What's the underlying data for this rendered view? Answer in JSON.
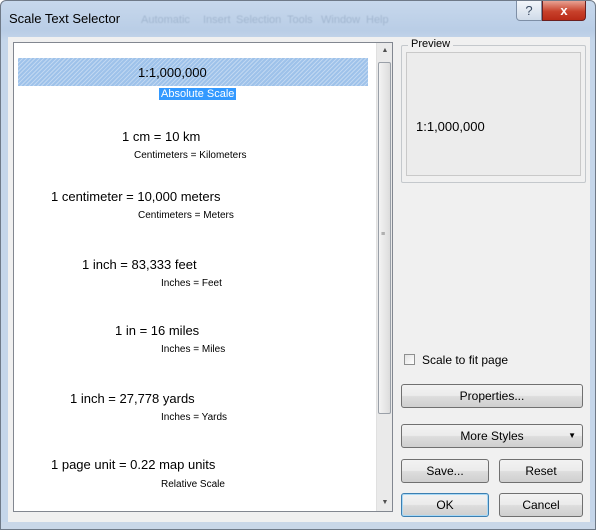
{
  "window": {
    "title": "Scale Text Selector",
    "background_menu_ghost": [
      "Automatic",
      "Insert",
      "Selection",
      "Tools",
      "Window",
      "Help"
    ],
    "help_glyph": "?",
    "close_glyph": "x"
  },
  "list": {
    "items": [
      {
        "main": "1:1,000,000",
        "sub": "Absolute Scale",
        "selected": true
      },
      {
        "main": "1 cm = 10 km",
        "sub": "Centimeters = Kilometers",
        "selected": false
      },
      {
        "main": "1 centimeter = 10,000 meters",
        "sub": "Centimeters = Meters",
        "selected": false
      },
      {
        "main": "1 inch = 83,333 feet",
        "sub": "Inches = Feet",
        "selected": false
      },
      {
        "main": "1 in = 16 miles",
        "sub": "Inches = Miles",
        "selected": false
      },
      {
        "main": "1 inch = 27,778 yards",
        "sub": "Inches = Yards",
        "selected": false
      },
      {
        "main": "1 page unit = 0.22 map units",
        "sub": "Relative Scale",
        "selected": false
      }
    ],
    "scroll_up_icon": "▲",
    "scroll_down_icon": "▼"
  },
  "preview": {
    "label": "Preview",
    "text": "1:1,000,000"
  },
  "options": {
    "scale_to_fit_label": "Scale to fit page",
    "scale_to_fit_checked": false
  },
  "buttons": {
    "properties": "Properties...",
    "more_styles": "More Styles",
    "more_styles_arrow": "▼",
    "save": "Save...",
    "reset": "Reset",
    "ok": "OK",
    "cancel": "Cancel"
  },
  "colors": {
    "selection_band": "#9ec2ea",
    "selection_highlight": "#3399ff",
    "title_bar": "#b9cde6",
    "close_button": "#c8412b"
  }
}
